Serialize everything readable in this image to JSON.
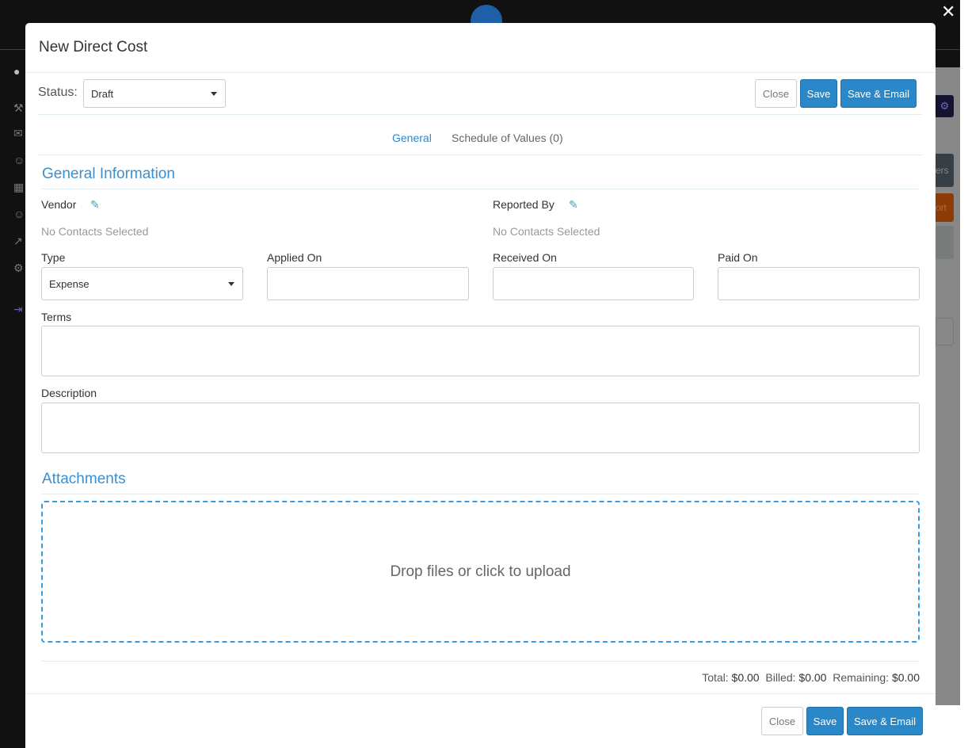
{
  "modal": {
    "title": "New Direct Cost",
    "status_label": "Status:",
    "status_value": "Draft",
    "buttons": {
      "close": "Close",
      "save": "Save",
      "save_email": "Save & Email"
    },
    "tabs": [
      {
        "label": "General",
        "active": true
      },
      {
        "label": "Schedule of Values (0)",
        "active": false
      }
    ],
    "general_section": "General Information",
    "vendor_label": "Vendor",
    "vendor_value": "No Contacts Selected",
    "reported_by_label": "Reported By",
    "reported_by_value": "No Contacts Selected",
    "type_label": "Type",
    "type_value": "Expense",
    "applied_on_label": "Applied On",
    "received_on_label": "Received On",
    "paid_on_label": "Paid On",
    "terms_label": "Terms",
    "description_label": "Description",
    "attachments_section": "Attachments",
    "drop_text": "Drop files or click to upload",
    "totals": {
      "total_label": "Total:",
      "total": "$0.00",
      "billed_label": "Billed:",
      "billed": "$0.00",
      "remaining_label": "Remaining:",
      "remaining": "$0.00"
    }
  },
  "background": {
    "button_partial_1": "ers",
    "button_partial_2": "ort"
  },
  "colors": {
    "primary": "#2a87c8",
    "accent": "#3a8fd0",
    "dashed": "#3a9ae0"
  }
}
